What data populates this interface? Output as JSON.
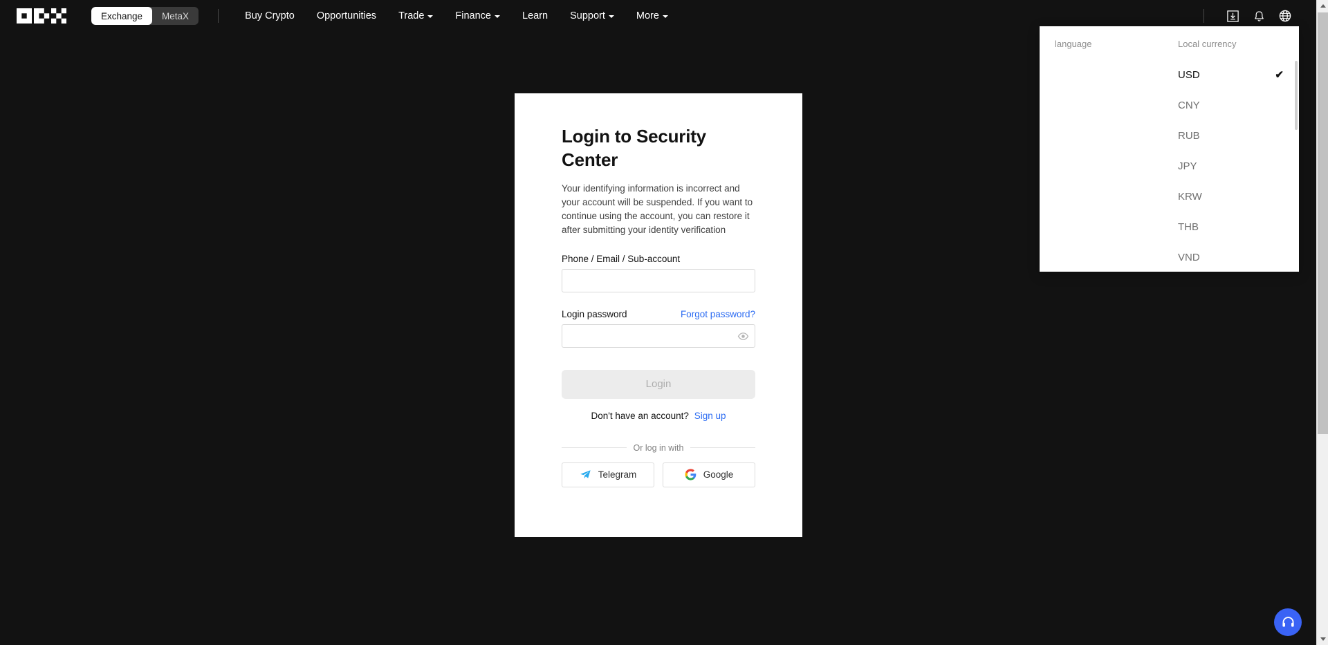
{
  "brand": {
    "logo_name": "okx-logo"
  },
  "topnav": {
    "toggle": {
      "options": [
        "Exchange",
        "MetaX"
      ],
      "active": "Exchange"
    },
    "links": [
      {
        "label": "Buy Crypto",
        "has_caret": false
      },
      {
        "label": "Opportunities",
        "has_caret": false
      },
      {
        "label": "Trade",
        "has_caret": true
      },
      {
        "label": "Finance",
        "has_caret": true
      },
      {
        "label": "Learn",
        "has_caret": false
      },
      {
        "label": "Support",
        "has_caret": true
      },
      {
        "label": "More",
        "has_caret": true
      }
    ],
    "icons": [
      {
        "name": "download-icon"
      },
      {
        "name": "bell-icon"
      },
      {
        "name": "globe-icon"
      }
    ]
  },
  "lang_dropdown": {
    "language_heading": "language",
    "currency_heading": "Local currency",
    "currencies": [
      {
        "code": "USD",
        "selected": true
      },
      {
        "code": "CNY",
        "selected": false
      },
      {
        "code": "RUB",
        "selected": false
      },
      {
        "code": "JPY",
        "selected": false
      },
      {
        "code": "KRW",
        "selected": false
      },
      {
        "code": "THB",
        "selected": false
      },
      {
        "code": "VND",
        "selected": false
      }
    ],
    "check_glyph": "✔"
  },
  "login_card": {
    "title": "Login to Security Center",
    "description": "Your identifying information is incorrect and your account will be suspended. If you want to continue using the account, you can restore it after submitting your identity verification",
    "account_label": "Phone / Email / Sub-account",
    "account_value": "",
    "account_placeholder": "",
    "password_label": "Login password",
    "forgot_password_label": "Forgot password?",
    "password_value": "",
    "password_placeholder": "",
    "login_button_label": "Login",
    "no_account_text": "Don't have an account?",
    "signup_label": "Sign up",
    "or_text": "Or log in with",
    "social": [
      {
        "label": "Telegram",
        "icon": "telegram-icon"
      },
      {
        "label": "Google",
        "icon": "google-icon"
      }
    ]
  },
  "support": {
    "icon": "headset-icon"
  },
  "colors": {
    "header_bg": "#121212",
    "page_bg": "#121212",
    "card_bg": "#ffffff",
    "link_blue": "#2b6bf2",
    "fab_blue": "#3a63f5",
    "disabled_btn": "#ececec"
  }
}
